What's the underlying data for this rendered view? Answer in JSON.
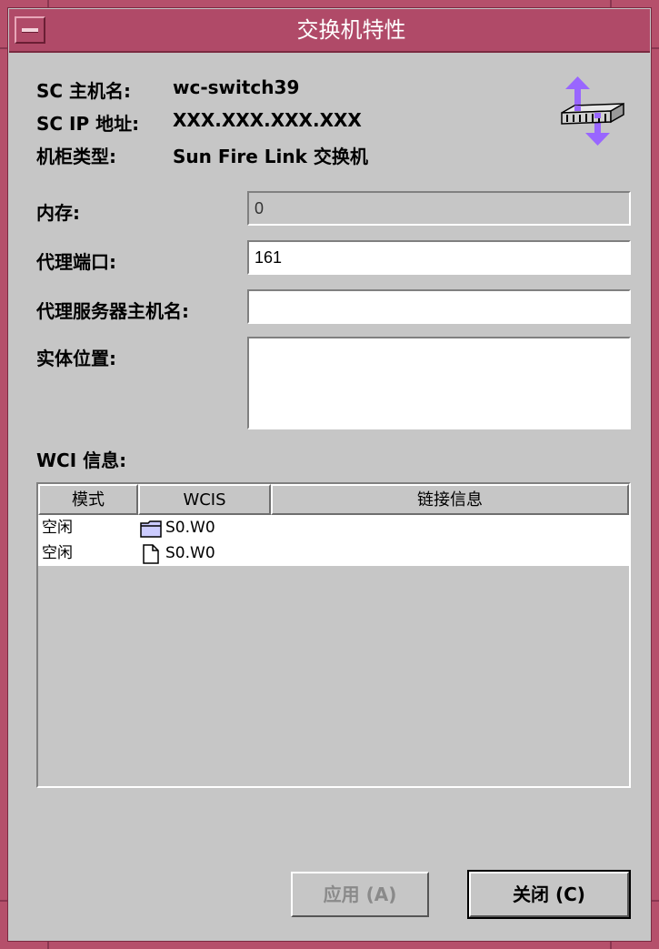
{
  "window": {
    "title": "交换机特性"
  },
  "info": {
    "host_label": "SC 主机名:",
    "host_value": "wc-switch39",
    "ip_label": "SC IP 地址:",
    "ip_value": "XXX.XXX.XXX.XXX",
    "cabinet_label": "机柜类型:",
    "cabinet_value": "Sun Fire Link 交换机"
  },
  "form": {
    "memory_label": "内存:",
    "memory_value": "0",
    "agent_port_label": "代理端口:",
    "agent_port_value": "161",
    "agent_host_label": "代理服务器主机名:",
    "agent_host_value": "",
    "location_label": "实体位置:",
    "location_value": ""
  },
  "wci": {
    "section_label": "WCI 信息:",
    "columns": [
      "模式",
      "WCIS",
      "链接信息"
    ],
    "rows": [
      {
        "mode": "空闲",
        "icon": "folder-icon",
        "wcis": "S0.W0",
        "link": ""
      },
      {
        "mode": "空闲",
        "icon": "file-icon",
        "wcis": "S0.W0",
        "link": ""
      }
    ]
  },
  "buttons": {
    "apply_label": "应用 (A)",
    "close_label": "关闭 (C)"
  },
  "icons": {
    "switch": "network-switch-icon"
  },
  "colors": {
    "frame": "#b5506b",
    "titlebar": "#b04a68",
    "background": "#c6c6c6",
    "icon_arrow": "#9966ff"
  }
}
